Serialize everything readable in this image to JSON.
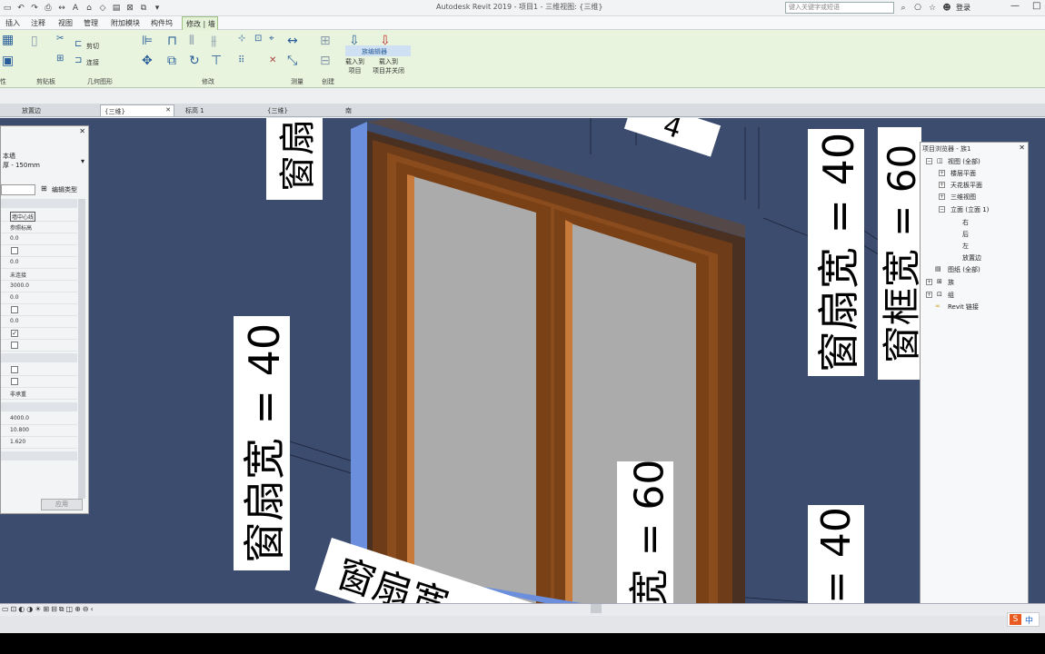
{
  "titlebar": {
    "doc_title": "Autodesk Revit 2019 - 项目1 - 三维视图: {三维}",
    "search_placeholder": "键入关键字或短语",
    "sign_in": "登录",
    "window_buttons": [
      "—",
      "□"
    ]
  },
  "menu": [
    "插入",
    "注释",
    "视图",
    "管理",
    "附加模块",
    "构件坞"
  ],
  "context_tab": "修改 | 墙",
  "ribbon": {
    "panels": [
      "性",
      "剪贴板",
      "几何图形",
      "修改",
      "测量",
      "创建"
    ],
    "edit_panel": "族编辑器",
    "small_buttons": [
      "剪切",
      "连接"
    ],
    "load_buttons": [
      "载入到\n项目",
      "载入到\n项目并关闭"
    ]
  },
  "view_tabs": [
    "放置边",
    "{三维}",
    "标高 1",
    "{三维}",
    "南"
  ],
  "viewport": {
    "annotations": [
      {
        "text": "窗扇"
      },
      {
        "text": "窗扇宽 = 40"
      },
      {
        "text": "窗扇宽 = 40"
      },
      {
        "text": "窗扇宽 = 40"
      },
      {
        "text": "窗框宽 = 60"
      },
      {
        "text": "宽 = 60"
      },
      {
        "text": "= 40"
      },
      {
        "text": "4"
      }
    ]
  },
  "properties": {
    "type_name": "本墙",
    "type_sub": "厚 - 150mm",
    "edit_type": "编辑类型",
    "apply": "应用",
    "rows": [
      "墙中心线",
      "参照标高",
      "0.0",
      "0.0",
      "未连接",
      "3000.0",
      "0.0",
      "0.0",
      "非承重",
      "4000.0",
      "10.800",
      "1.620"
    ]
  },
  "project_browser": {
    "title": "项目浏览器 - 族1",
    "items": [
      "视图 (全部)",
      "楼层平面",
      "天花板平面",
      "三维视图",
      "立面 (立面 1)",
      "右",
      "后",
      "左",
      "放置边",
      "图纸 (全部)",
      "族",
      "组",
      "Revit 链接"
    ]
  },
  "ime": {
    "logo": "S",
    "mode": "中"
  }
}
